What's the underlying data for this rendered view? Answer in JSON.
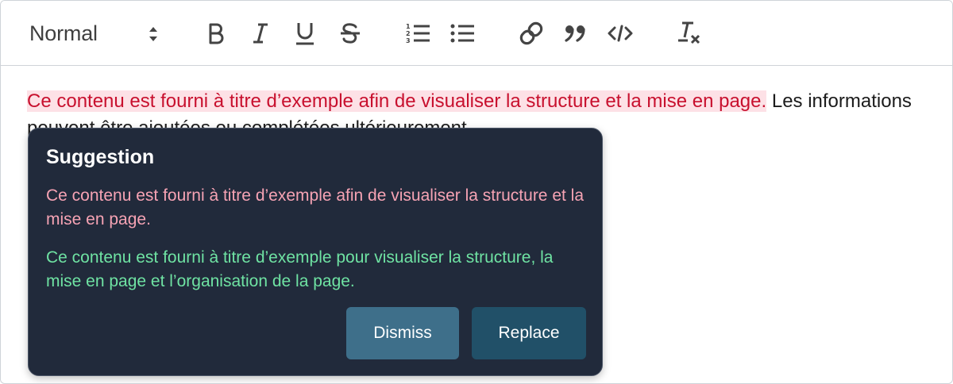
{
  "toolbar": {
    "format_select": {
      "selected": "Normal"
    },
    "buttons": [
      {
        "name": "bold-button",
        "icon": "bold-icon"
      },
      {
        "name": "italic-button",
        "icon": "italic-icon"
      },
      {
        "name": "underline-button",
        "icon": "underline-icon"
      },
      {
        "name": "strikethrough-button",
        "icon": "strikethrough-icon"
      },
      {
        "name": "ordered-list-button",
        "icon": "ordered-list-icon"
      },
      {
        "name": "bullet-list-button",
        "icon": "bullet-list-icon"
      },
      {
        "name": "link-button",
        "icon": "link-icon"
      },
      {
        "name": "blockquote-button",
        "icon": "quote-icon"
      },
      {
        "name": "code-button",
        "icon": "code-icon"
      },
      {
        "name": "clear-format-button",
        "icon": "clear-format-icon"
      }
    ]
  },
  "editor": {
    "flagged_text": "Ce contenu est fourni à titre d’exemple afin de visualiser la structure et la mise en page.",
    "rest_text": " Les informations peuvent être ajoutées ou complétées ultérieurement."
  },
  "suggestion": {
    "title": "Suggestion",
    "original": "Ce contenu est fourni à titre d’exemple afin de visualiser la structure et la mise en page.",
    "replacement": "Ce contenu est fourni à titre d’exemple pour visualiser la structure, la mise en page et l’organisation de la page.",
    "dismiss_label": "Dismiss",
    "replace_label": "Replace"
  },
  "colors": {
    "flag_background": "#fde1e6",
    "flag_text": "#c8102e",
    "popup_background": "#212a3b",
    "original_text": "#f6a3b4",
    "replacement_text": "#6fe3a3",
    "dismiss_button": "#3e6f8a",
    "replace_button": "#215068"
  }
}
